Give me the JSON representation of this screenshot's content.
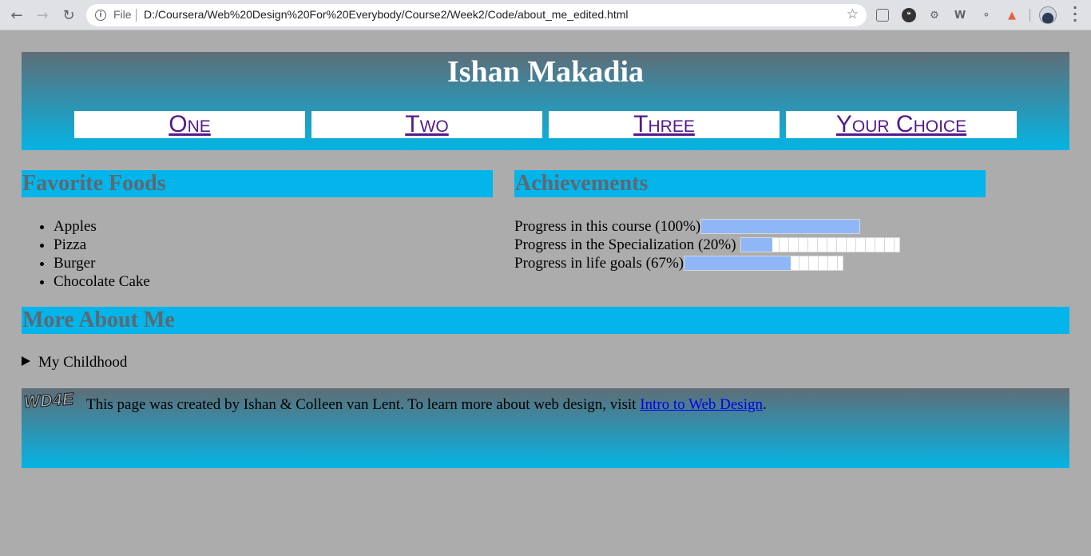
{
  "browser": {
    "scheme_label": "File",
    "url": "D:/Coursera/Web%20Design%20For%20Everybody/Course2/Week2/Code/about_me_edited.html",
    "icons": [
      "back-icon",
      "forward-icon",
      "reload-icon",
      "info-icon",
      "star-icon",
      "extension-icon",
      "chat-icon",
      "gear-icon",
      "w-icon",
      "key-icon",
      "shield-icon",
      "avatar",
      "menu-icon"
    ]
  },
  "header": {
    "title": "Ishan Makadia",
    "nav": [
      "One",
      "Two",
      "Three",
      "Your Choice"
    ]
  },
  "foods": {
    "heading": "Favorite Foods",
    "items": [
      "Apples",
      "Pizza",
      "Burger",
      "Chocolate Cake"
    ]
  },
  "achievements": {
    "heading": "Achievements",
    "items": [
      {
        "label": "Progress in this course (100%)",
        "progress": 1.0
      },
      {
        "label": "Progress in the Specialization (20%)",
        "progress": 0.2
      },
      {
        "label": "Progress in life goals (67%)",
        "progress": 0.67
      }
    ]
  },
  "more": {
    "heading": "More About Me",
    "summary": "My Childhood"
  },
  "footer": {
    "logo_text": "WD4E",
    "text_before": "This page was created by Ishan & Colleen van Lent. To learn more about web design, visit ",
    "link_text": "Intro to Web Design",
    "text_after": "."
  },
  "colors": {
    "page_bg": "#acacac",
    "section_bg": "#03b5ea",
    "gradient_top": "#5e6d77",
    "progress_fill": "#8fb7f7",
    "visited_link": "#551a8b",
    "link": "#0000ee"
  }
}
